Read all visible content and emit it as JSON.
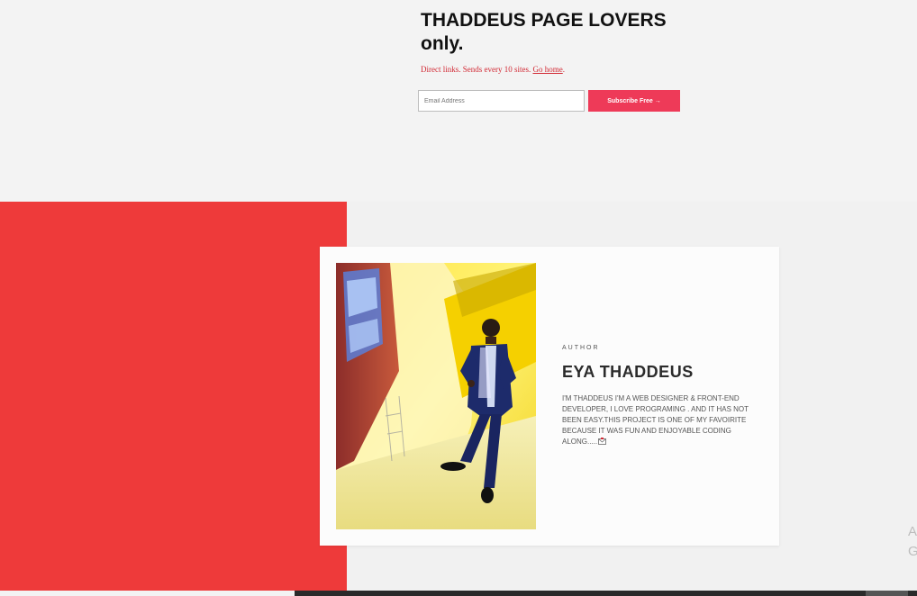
{
  "newsletter": {
    "headline": "THADDEUS PAGE LOVERS only.",
    "subtext_prefix": "Direct links. Sends every 10 sites. ",
    "go_home_link": "Go home",
    "subtext_suffix": ".",
    "email_placeholder": "Email Address",
    "email_value": "",
    "subscribe_label": "Subscribe Free →"
  },
  "author": {
    "kicker": "AUTHOR",
    "name": "EYA THADDEUS",
    "bio": "I'M THADDEUS I'M A WEB DESIGNER & FRONT-END DEVELOPER, I LOVE PROGRAMING . AND IT HAS NOT BEEN EASY.THIS PROJECT IS ONE OF MY FAVOIRITE BECAUSE IT WAS FUN AND ENJOYABLE CODING ALONG.....",
    "bio_icon": "envelope-icon",
    "photo_icon": "author-photo"
  },
  "edge_text": "A\nG",
  "colors": {
    "accent_red": "#ee3a3a",
    "button_pink": "#ee3a58",
    "link_red": "#d22a35",
    "background": "#f3f3f3"
  }
}
